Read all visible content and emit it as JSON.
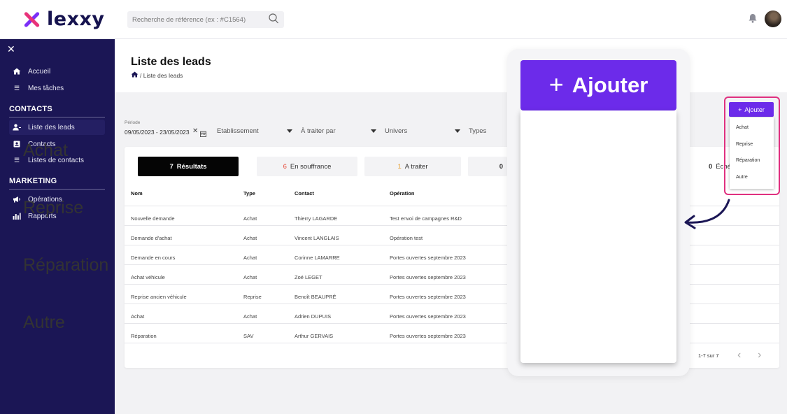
{
  "brand": {
    "name": "lexxy"
  },
  "search": {
    "placeholder": "Recherche de référence (ex : #C1564)"
  },
  "sidebar": {
    "top_items": [
      {
        "label": "Accueil",
        "icon": "home-icon"
      },
      {
        "label": "Mes tâches",
        "icon": "task-list-icon"
      }
    ],
    "sections": [
      {
        "title": "CONTACTS",
        "items": [
          {
            "label": "Liste des leads",
            "icon": "user-icon",
            "active": true
          },
          {
            "label": "Contacts",
            "icon": "contact-card-icon"
          },
          {
            "label": "Listes de contacts",
            "icon": "contact-list-icon"
          }
        ]
      },
      {
        "title": "MARKETING",
        "items": [
          {
            "label": "Opérations",
            "icon": "megaphone-icon"
          },
          {
            "label": "Rapports",
            "icon": "bar-chart-icon"
          }
        ]
      }
    ]
  },
  "page": {
    "title": "Liste des leads",
    "breadcrumb": "/ Liste des leads"
  },
  "filters": {
    "period_label": "Période",
    "period_value": "09/05/2023 - 23/05/2023",
    "dropdowns": [
      "Etablissement",
      "À traiter par",
      "Univers",
      "Types"
    ]
  },
  "tabs": [
    {
      "count": "7",
      "label": "Résultats",
      "color": "#ffffff",
      "active": true
    },
    {
      "count": "6",
      "label": "En souffrance",
      "color": "#e74c3c"
    },
    {
      "count": "1",
      "label": "A traiter",
      "color": "#e8a33c"
    },
    {
      "count": "0",
      "label": "",
      "color": "#333333"
    },
    {
      "count": "0",
      "label": "Éché",
      "color": "#333333"
    }
  ],
  "table": {
    "headers": [
      "Nom",
      "Type",
      "Contact",
      "Opération"
    ],
    "rows": [
      [
        "Nouvelle demande",
        "Achat",
        "Thierry LAGARDE",
        "Test envoi de campagnes R&D"
      ],
      [
        "Demande d'achat",
        "Achat",
        "Vincent LANGLAIS",
        "Opération test"
      ],
      [
        "Demande en cours",
        "Achat",
        "Corinne LAMARRE",
        "Portes ouvertes septembre 2023"
      ],
      [
        "Achat véhicule",
        "Achat",
        "Zoé LEGET",
        "Portes ouvertes septembre 2023"
      ],
      [
        "Reprise ancien véhicule",
        "Reprise",
        "Benoît BEAUPRÉ",
        "Portes ouvertes septembre 2023"
      ],
      [
        "Achat",
        "Achat",
        "Adrien DUPUIS",
        "Portes ouvertes septembre 2023"
      ],
      [
        "Réparation",
        "SAV",
        "Arthur GERVAIS",
        "Portes ouvertes septembre 2023"
      ]
    ]
  },
  "pagination": {
    "range": "1-7 sur 7"
  },
  "add_menu": {
    "button_label": "Ajouter",
    "options": [
      "Achat",
      "Reprise",
      "Réparation",
      "Autre"
    ]
  },
  "colors": {
    "sidebar_bg": "#1b1655",
    "accent_purple": "#6c2bea",
    "highlight_pink": "#e0307f",
    "arrow_navy": "#1b1655"
  }
}
